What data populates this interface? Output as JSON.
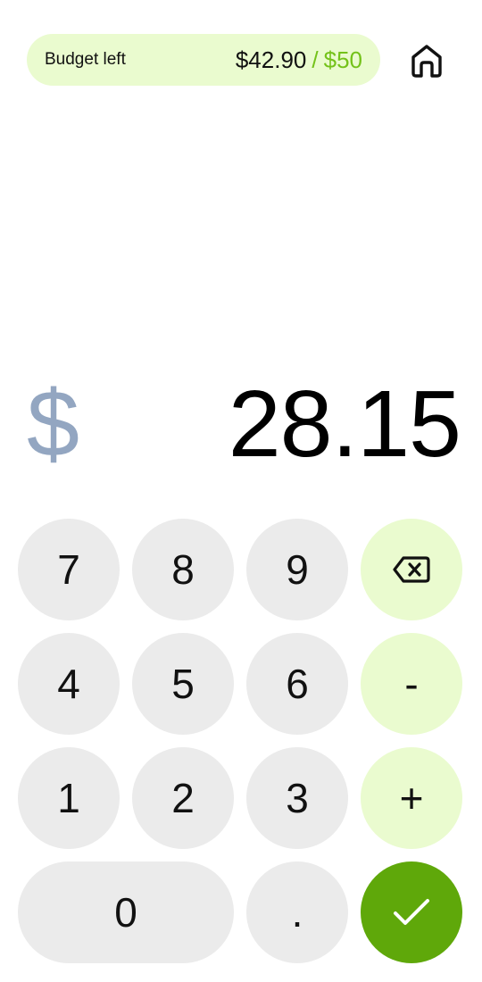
{
  "budget": {
    "label": "Budget left",
    "remaining": "$42.90",
    "separator": "/",
    "total": "$50"
  },
  "amount": {
    "currency": "$",
    "value": "28.15"
  },
  "keypad": {
    "k7": "7",
    "k8": "8",
    "k9": "9",
    "k4": "4",
    "k5": "5",
    "k6": "6",
    "k1": "1",
    "k2": "2",
    "k3": "3",
    "k0": "0",
    "decimal": ".",
    "minus": "-",
    "plus": "+"
  },
  "icons": {
    "home": "home-icon",
    "backspace": "backspace-icon",
    "submit": "checkmark-icon"
  },
  "colors": {
    "accent_light": "#eafbcf",
    "accent_green": "#74c21a",
    "submit_green": "#5fa80a",
    "key_gray": "#ebebeb",
    "currency_gray": "#93a6c1"
  }
}
